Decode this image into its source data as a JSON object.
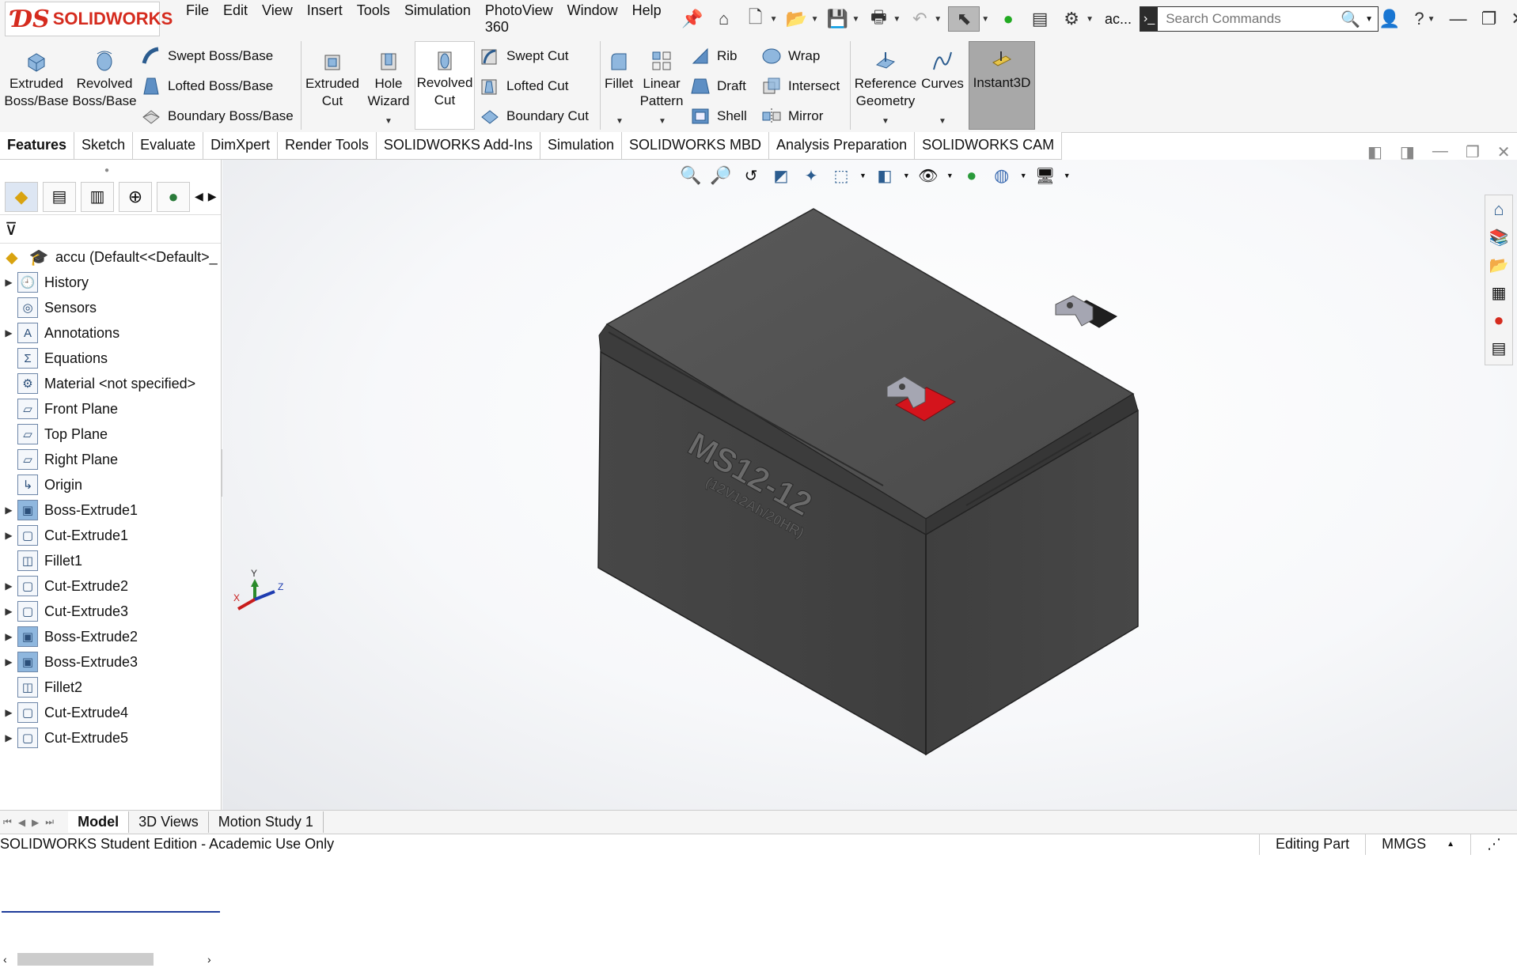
{
  "app": {
    "brand": "SOLIDWORKS",
    "doc_title": "ac..."
  },
  "menus": [
    "File",
    "Edit",
    "View",
    "Insert",
    "Tools",
    "Simulation",
    "PhotoView 360",
    "Window",
    "Help"
  ],
  "search": {
    "placeholder": "Search Commands"
  },
  "commands": {
    "extruded_boss": [
      "Extruded",
      "Boss/Base"
    ],
    "revolved_boss": [
      "Revolved",
      "Boss/Base"
    ],
    "swept_boss": "Swept Boss/Base",
    "lofted_boss": "Lofted Boss/Base",
    "boundary_boss": "Boundary Boss/Base",
    "extruded_cut": [
      "Extruded",
      "Cut"
    ],
    "hole_wizard": [
      "Hole",
      "Wizard"
    ],
    "revolved_cut": [
      "Revolved",
      "Cut"
    ],
    "swept_cut": "Swept Cut",
    "lofted_cut": "Lofted Cut",
    "boundary_cut": "Boundary Cut",
    "fillet": "Fillet",
    "linear_pattern": [
      "Linear",
      "Pattern"
    ],
    "rib": "Rib",
    "draft": "Draft",
    "shell": "Shell",
    "wrap": "Wrap",
    "intersect": "Intersect",
    "mirror": "Mirror",
    "reference_geometry": [
      "Reference",
      "Geometry"
    ],
    "curves": "Curves",
    "instant3d": "Instant3D"
  },
  "tabs": [
    "Features",
    "Sketch",
    "Evaluate",
    "DimXpert",
    "Render Tools",
    "SOLIDWORKS Add-Ins",
    "Simulation",
    "SOLIDWORKS MBD",
    "Analysis Preparation",
    "SOLIDWORKS CAM"
  ],
  "tree": {
    "root": "accu  (Default<<Default>_",
    "items": [
      {
        "label": "History",
        "icon": "history-icon",
        "expandable": true
      },
      {
        "label": "Sensors",
        "icon": "sensors-icon",
        "expandable": false
      },
      {
        "label": "Annotations",
        "icon": "annotations-icon",
        "expandable": true
      },
      {
        "label": "Equations",
        "icon": "equations-icon",
        "expandable": false
      },
      {
        "label": "Material <not specified>",
        "icon": "material-icon",
        "expandable": false
      },
      {
        "label": "Front Plane",
        "icon": "plane-icon",
        "expandable": false
      },
      {
        "label": "Top Plane",
        "icon": "plane-icon",
        "expandable": false
      },
      {
        "label": "Right Plane",
        "icon": "plane-icon",
        "expandable": false
      },
      {
        "label": "Origin",
        "icon": "origin-icon",
        "expandable": false
      },
      {
        "label": "Boss-Extrude1",
        "icon": "boss-extrude-icon",
        "expandable": true
      },
      {
        "label": "Cut-Extrude1",
        "icon": "cut-extrude-icon",
        "expandable": true
      },
      {
        "label": "Fillet1",
        "icon": "fillet-icon",
        "expandable": false
      },
      {
        "label": "Cut-Extrude2",
        "icon": "cut-extrude-icon",
        "expandable": true
      },
      {
        "label": "Cut-Extrude3",
        "icon": "cut-extrude-icon",
        "expandable": true
      },
      {
        "label": "Boss-Extrude2",
        "icon": "boss-extrude-icon",
        "expandable": true
      },
      {
        "label": "Boss-Extrude3",
        "icon": "boss-extrude-icon",
        "expandable": true
      },
      {
        "label": "Fillet2",
        "icon": "fillet-icon",
        "expandable": false
      },
      {
        "label": "Cut-Extrude4",
        "icon": "cut-extrude-icon",
        "expandable": true
      },
      {
        "label": "Cut-Extrude5",
        "icon": "cut-extrude-icon",
        "expandable": true
      }
    ]
  },
  "model": {
    "label_main": "MS12-12",
    "label_sub": "(12V12Ah/20HR)"
  },
  "triad": {
    "x": "X",
    "y": "Y",
    "z": "Z"
  },
  "bottom_tabs": [
    "Model",
    "3D Views",
    "Motion Study 1"
  ],
  "status": {
    "left": "SOLIDWORKS Student Edition - Academic Use Only",
    "mode": "Editing Part",
    "units": "MMGS"
  },
  "colors": {
    "brand": "#d52b1e",
    "body": "#4a4a4a",
    "terminal_red": "#d4141c",
    "accent_blue": "#1e3c9a"
  }
}
